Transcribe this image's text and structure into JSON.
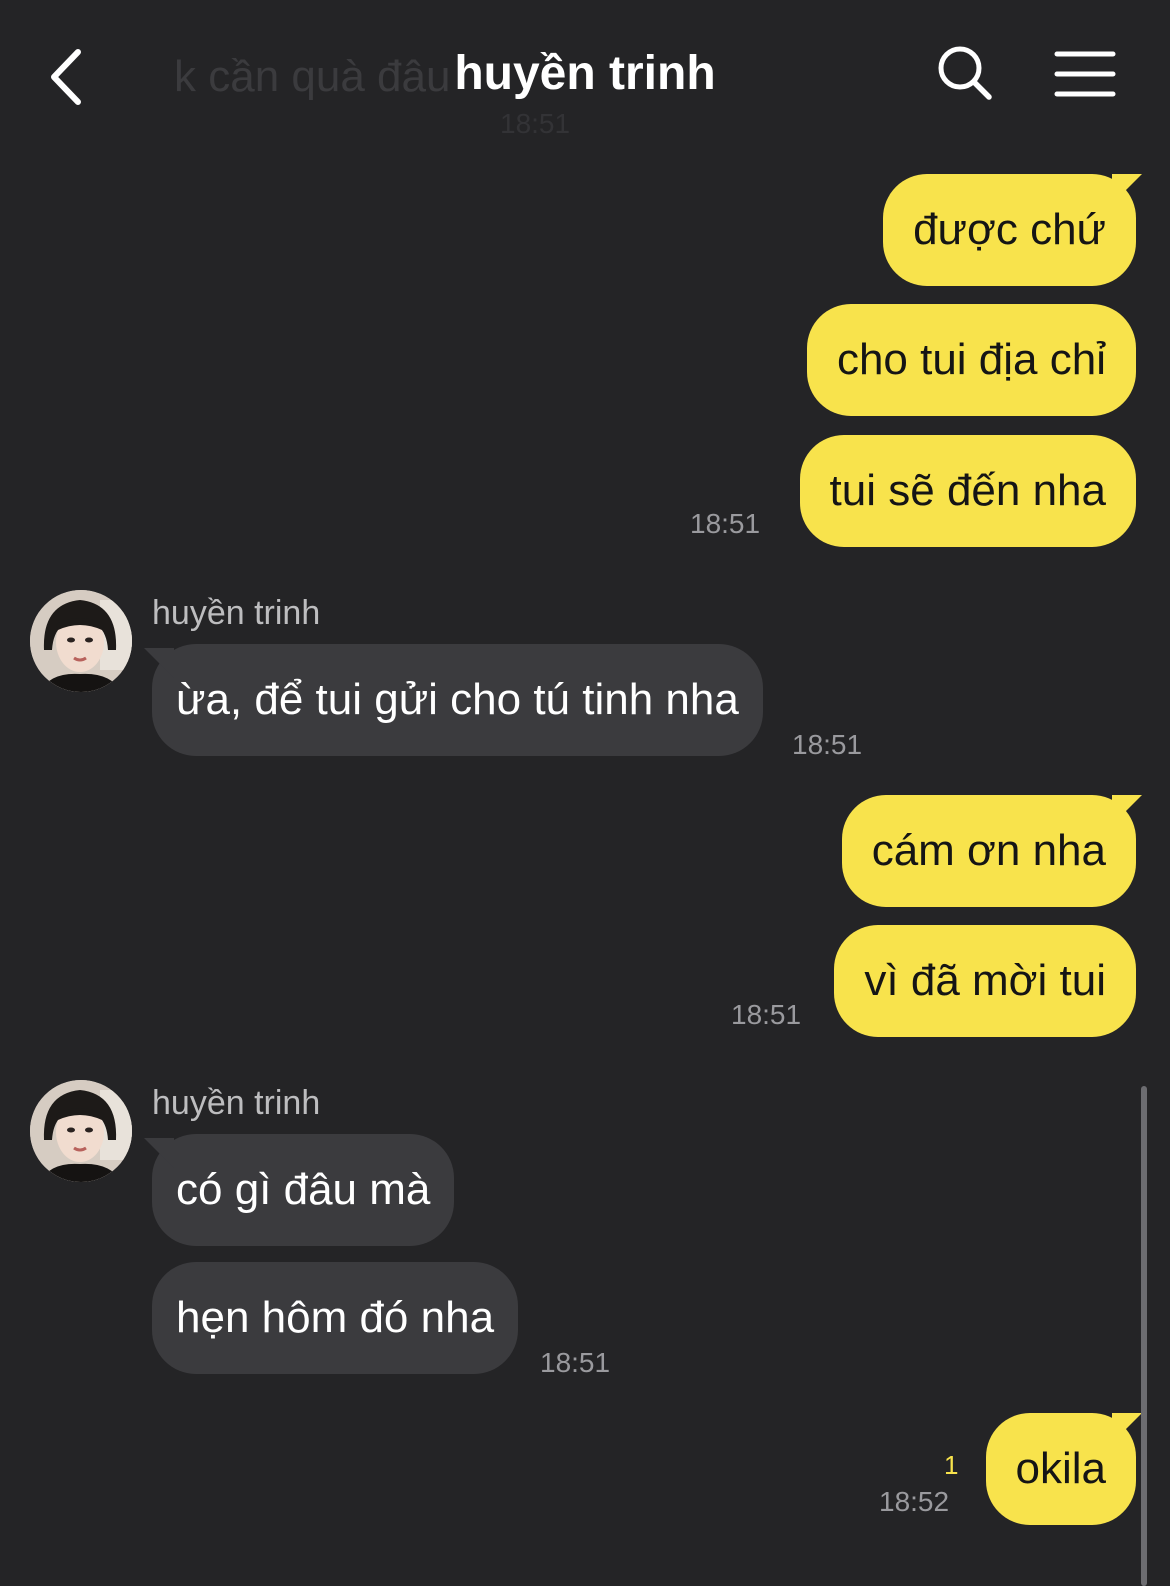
{
  "header": {
    "title": "huyền trinh",
    "ghost_preview": "k cần quà đâu",
    "ghost_time": "18:51",
    "back_icon": "chevron-left-icon",
    "search_icon": "search-icon",
    "menu_icon": "hamburger-menu-icon"
  },
  "colors": {
    "background": "#242426",
    "sent_bubble": "#f8e34c",
    "received_bubble": "#3b3b3e",
    "unread_badge": "#f8e34c"
  },
  "messages": {
    "m1": "được chứ",
    "m2": "cho tui địa chỉ",
    "m3": "tui sẽ đến nha",
    "t1": "18:51",
    "r1_sender": "huyền trinh",
    "r1": "ừa, để tui gửi cho tú tinh nha",
    "t2": "18:51",
    "m4": "cám ơn nha",
    "m5": "vì đã mời tui",
    "t3": "18:51",
    "r2_sender": "huyền trinh",
    "r2": "có gì đâu mà",
    "r3": "hẹn hôm đó nha",
    "t4": "18:51",
    "m6": "okila",
    "m6_unread": "1",
    "t5": "18:52"
  }
}
